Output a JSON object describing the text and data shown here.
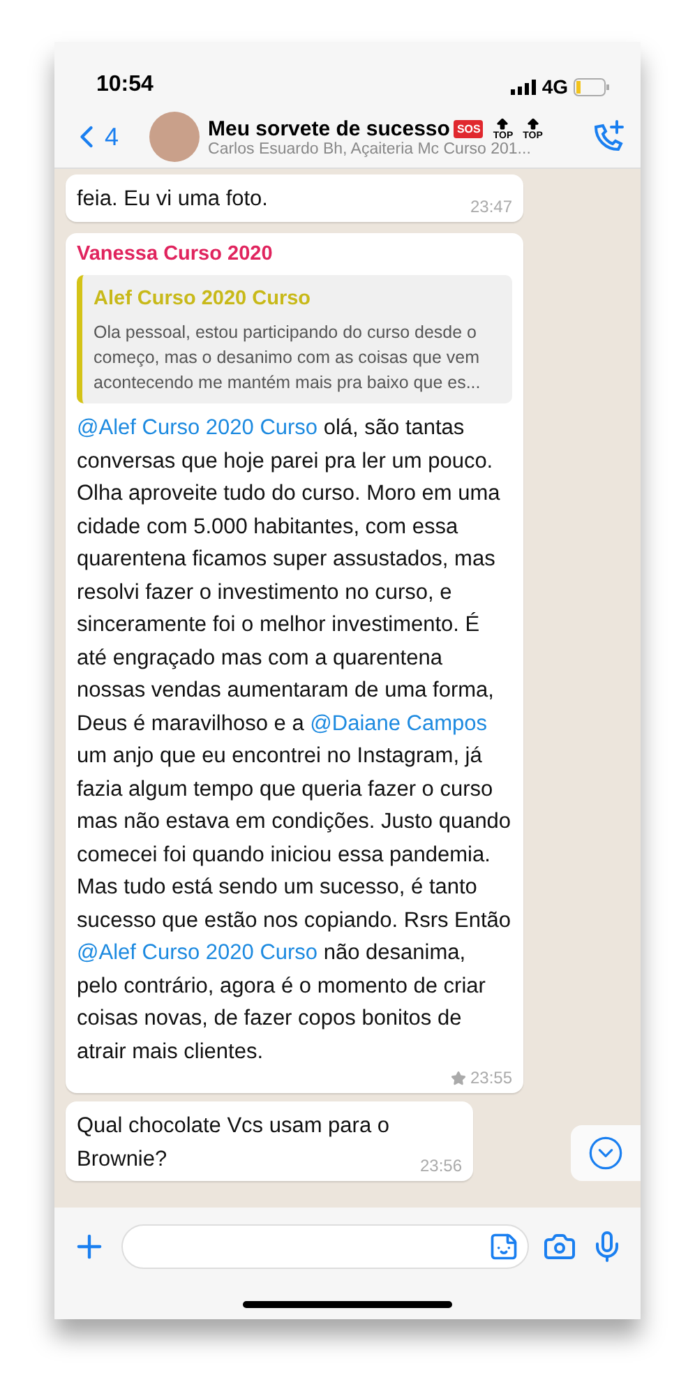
{
  "status_bar": {
    "time": "10:54",
    "network": "4G"
  },
  "header": {
    "back_count": "4",
    "title": "Meu sorvete de sucesso",
    "badges": [
      {
        "kind": "sos",
        "text": "SOS"
      },
      {
        "kind": "top",
        "text": "TOP"
      },
      {
        "kind": "top",
        "text": "TOP"
      }
    ],
    "subtitle": "Carlos Esuardo Bh, Açaiteria Mc Curso 201..."
  },
  "messages": [
    {
      "kind": "partial",
      "text": "feia. Eu vi uma foto.",
      "time": "23:47"
    },
    {
      "kind": "reply",
      "sender": "Vanessa Curso 2020",
      "quote": {
        "author": "Alef Curso 2020  Curso",
        "text": "Ola pessoal, estou participando do curso desde o começo, mas o desanimo com as coisas que vem acontecendo me mantém mais pra baixo que es..."
      },
      "body": [
        {
          "kind": "mention",
          "text": "@Alef Curso 2020  Curso"
        },
        {
          "kind": "text",
          "text": " olá, são tantas conversas que hoje parei pra ler um pouco. Olha aproveite tudo do curso. Moro em uma cidade com 5.000 habitantes, com essa quarentena ficamos super assustados, mas resolvi fazer o investimento no curso, e sinceramente foi o melhor investimento. É até engraçado mas com a quarentena nossas vendas aumentaram de uma forma, Deus é maravilhoso e a "
        },
        {
          "kind": "mention",
          "text": "@Daiane Campos"
        },
        {
          "kind": "text",
          "text": " um anjo que eu encontrei no Instagram, já fazia algum tempo que queria fazer o curso mas não estava em condições. Justo quando comecei foi quando iniciou essa pandemia. Mas tudo está sendo um sucesso, é tanto sucesso que estão nos copiando. Rsrs Então "
        },
        {
          "kind": "mention",
          "text": "@Alef Curso 2020  Curso"
        },
        {
          "kind": "text",
          "text": " não desanima, pelo contrário, agora é o momento de criar coisas novas, de fazer copos bonitos de atrair mais clientes."
        }
      ],
      "time": "23:55",
      "starred": true
    },
    {
      "kind": "plain",
      "text": "Qual chocolate Vcs usam para o Brownie?",
      "time": "23:56"
    }
  ]
}
